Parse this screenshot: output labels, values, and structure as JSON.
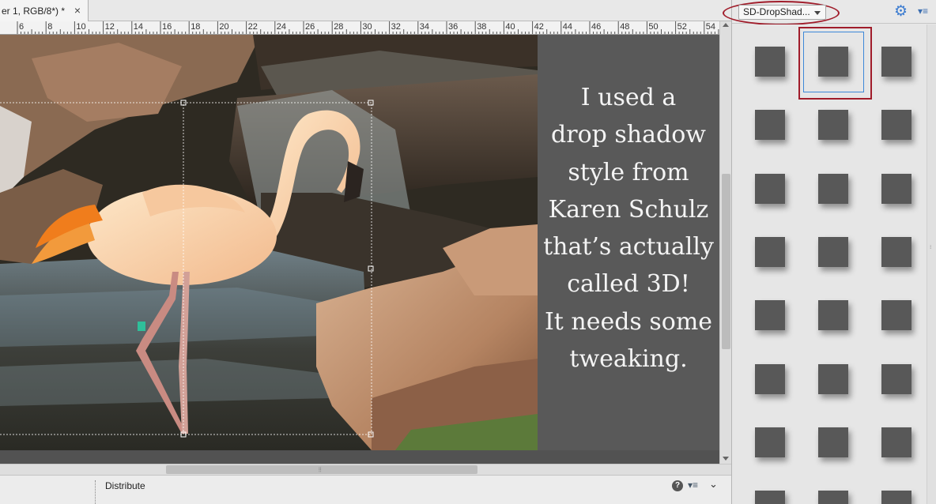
{
  "document": {
    "tab_title": "er 1, RGB/8*) *",
    "close_symbol": "×"
  },
  "ruler": {
    "labels": [
      "6",
      "8",
      "10",
      "12",
      "14",
      "16",
      "18",
      "20",
      "22",
      "24",
      "26",
      "28",
      "30",
      "32",
      "34",
      "36",
      "38",
      "40",
      "42",
      "44",
      "46",
      "48",
      "50",
      "52",
      "54"
    ]
  },
  "canvas": {
    "quote_lines": [
      "I used a",
      "drop shadow",
      "style from",
      "Karen Schulz",
      "that’s actually",
      "called 3D!",
      "It needs some",
      "tweaking."
    ],
    "background_color": "#525252",
    "text_panel_color": "#595959"
  },
  "options_bar": {
    "label": "Distribute",
    "help_symbol": "?",
    "menu_symbol": "▾≡",
    "collapse_symbol": "⌄"
  },
  "styles_panel": {
    "dropdown_value": "SD-DropShad...",
    "gear_icon": "gear-icon",
    "menu_icon": "panel-menu-icon",
    "columns": 3,
    "rows": 8,
    "swatch_color": "#585858",
    "selected_index": 1,
    "highlight_color": "#a01c2a",
    "selection_color": "#3d88d8"
  }
}
